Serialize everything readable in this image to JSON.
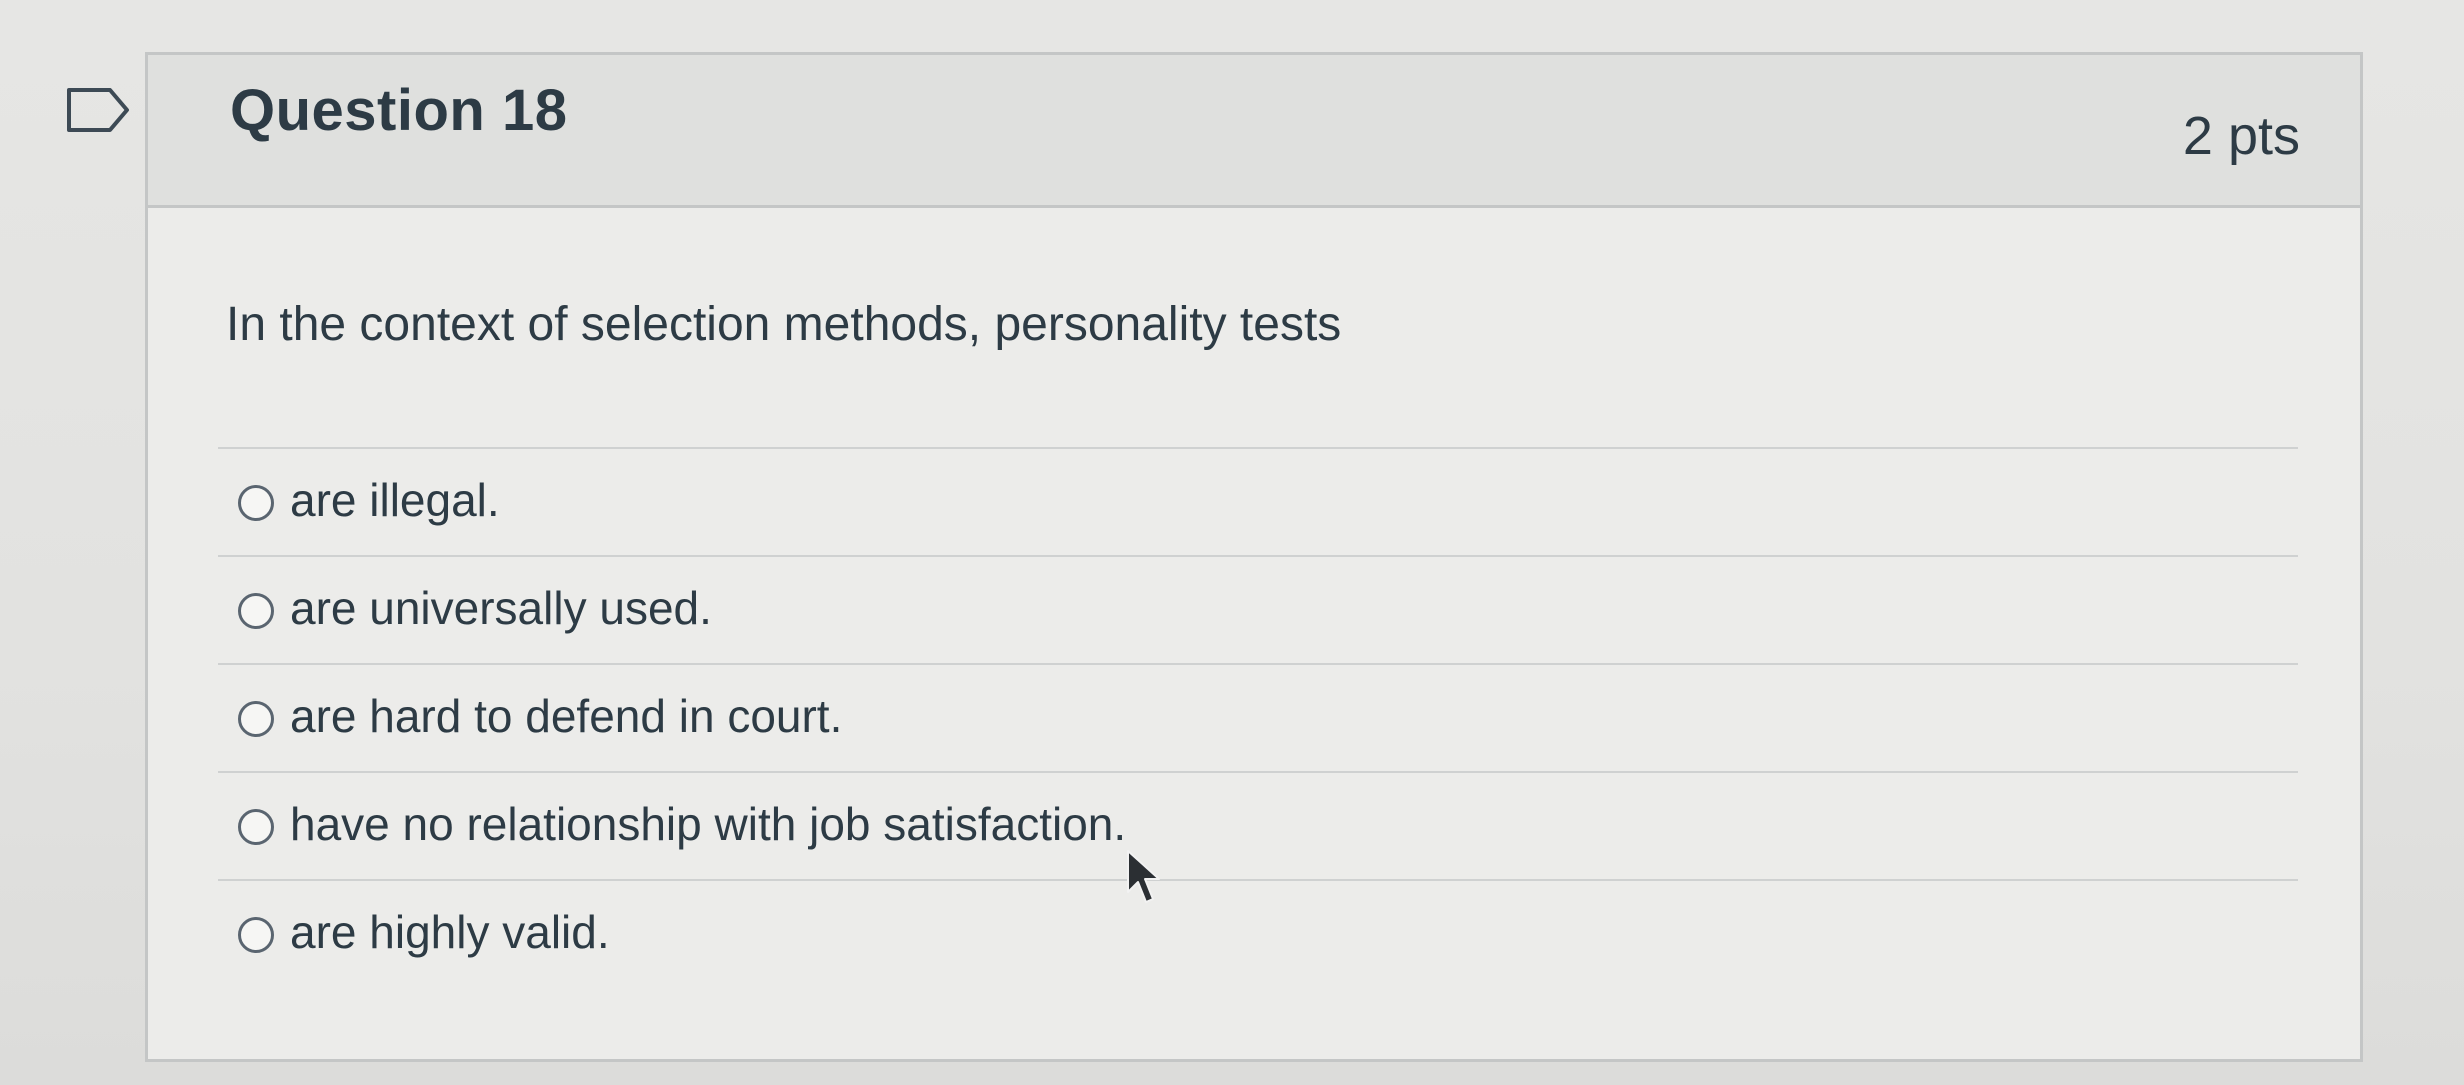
{
  "question": {
    "title": "Question 18",
    "points": "2 pts",
    "text": "In the context of selection methods, personality tests",
    "answers": [
      {
        "label": "are illegal.",
        "selected": false
      },
      {
        "label": "are universally used.",
        "selected": false
      },
      {
        "label": "are hard to defend in court.",
        "selected": false
      },
      {
        "label": "have no relationship with job satisfaction.",
        "selected": false
      },
      {
        "label": "are highly valid.",
        "selected": false
      }
    ]
  },
  "icons": {
    "flag": "flag-question-icon",
    "cursor": "mouse-pointer-icon"
  },
  "colors": {
    "text": "#2d3b45",
    "header_bg": "#dfe0de",
    "border": "#c4c6c6"
  }
}
